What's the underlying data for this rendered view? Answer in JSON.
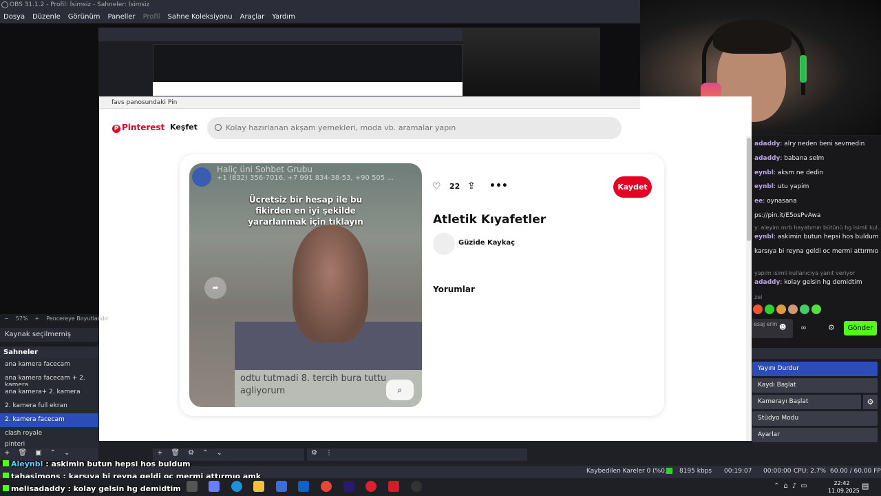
{
  "obs": {
    "title": "OBS 31.1.2 - Profil: İsimsiz - Sahneler: İsimsiz",
    "menu": [
      "Dosya",
      "Düzenle",
      "Görünüm",
      "Paneller",
      "Profil",
      "Sahne Koleksiyonu",
      "Araçlar",
      "Yardım"
    ],
    "zoom": "57%",
    "fit_label": "Pencereye Boyutlandır",
    "no_source": "Kaynak seçilmemiş",
    "scenes_header": "Sahneler",
    "scenes": [
      "ana kamera facecam",
      "ana kamera facecam + 2. kamera",
      "ana kamera+ 2. kamera",
      "2. kamera full ekran",
      "2. kamera  facecam",
      "clash royale",
      "pinteri"
    ],
    "selected_scene_index": 4,
    "controls": {
      "stop_stream": "Yayını Durdur",
      "start_record": "Kaydı Başlat",
      "start_camera": "Kamerayı Başlat",
      "studio_mode": "Stüdyo Modu",
      "settings": "Ayarlar"
    },
    "status": {
      "dropped": "Kaybedilen Kareler 0 (%0.0)",
      "bitrate": "8195 kbps",
      "stream_time": "00:19:07",
      "rec_time": "00:00:00",
      "cpu": "CPU: 2.7%",
      "fps": "60.00 / 60.00 FPS"
    }
  },
  "pin_window": {
    "title": "favs panosundaki Pin",
    "logo": "Pinterest",
    "explore": "Keşfet",
    "search_placeholder": "Kolay hazırlanan akşam yemekleri, moda vb. aramalar yapın",
    "image_header": "Haliç üni Sohbet Grubu",
    "image_numbers": "+1 (832) 356-7016, +7 991 834-38-53, +90 505 ...",
    "image_overlay": "Ücretsiz bir hesap ile bu fikirden en iyi şekilde yararlanmak için tıklayın",
    "image_caption": "odtu tutmadi 8. tercih bura tuttu agliyorum",
    "likes": "22",
    "save_label": "Kaydet",
    "pin_title": "Atletik Kıyafetler",
    "author": "Güzide Kaykaç",
    "comments_label": "Yorumlar"
  },
  "chat": {
    "lines": [
      {
        "user": "adaddy",
        "text": "alry neden beni sevmedin"
      },
      {
        "user": "adaddy",
        "text": "babana selm"
      },
      {
        "user": "eynbl",
        "text": "aksm ne dedin"
      },
      {
        "user": "eynbl",
        "text": "utu yapim"
      },
      {
        "user": "ee",
        "text": "oynasana"
      },
      {
        "user": "",
        "text": "ps://pin.it/E5osPvAwa"
      },
      {
        "user": "",
        "text": "y: aleyim mrb hayatımın bütünü hg isimli kul..."
      },
      {
        "user": "eynbl",
        "text": "askimin butun hepsi hos buldum"
      },
      {
        "user": "",
        "text": "karsıya bi reyna geldi oc mermi attırmıo"
      },
      {
        "user": "",
        "text": "yapim isimli kullanıcıya yanıt veriyor"
      },
      {
        "user": "adaddy",
        "text": "kolay gelsin hg demidtim"
      },
      {
        "user": "",
        "text": "zel"
      }
    ],
    "input_placeholder": "esaj erin",
    "send": "Gönder"
  },
  "overlay_chat": [
    {
      "user": "Aleynbl",
      "text": "askimin butun hepsi hos buldum"
    },
    {
      "user": "tahasimons",
      "text": "karsıya bi reyna geldi oc mermi attırmıo amk"
    },
    {
      "user": "melisadaddy",
      "text": "kolay gelsin hg demidtim"
    }
  ],
  "taskbar": {
    "time": "22:42",
    "date": "11.09.2025"
  }
}
